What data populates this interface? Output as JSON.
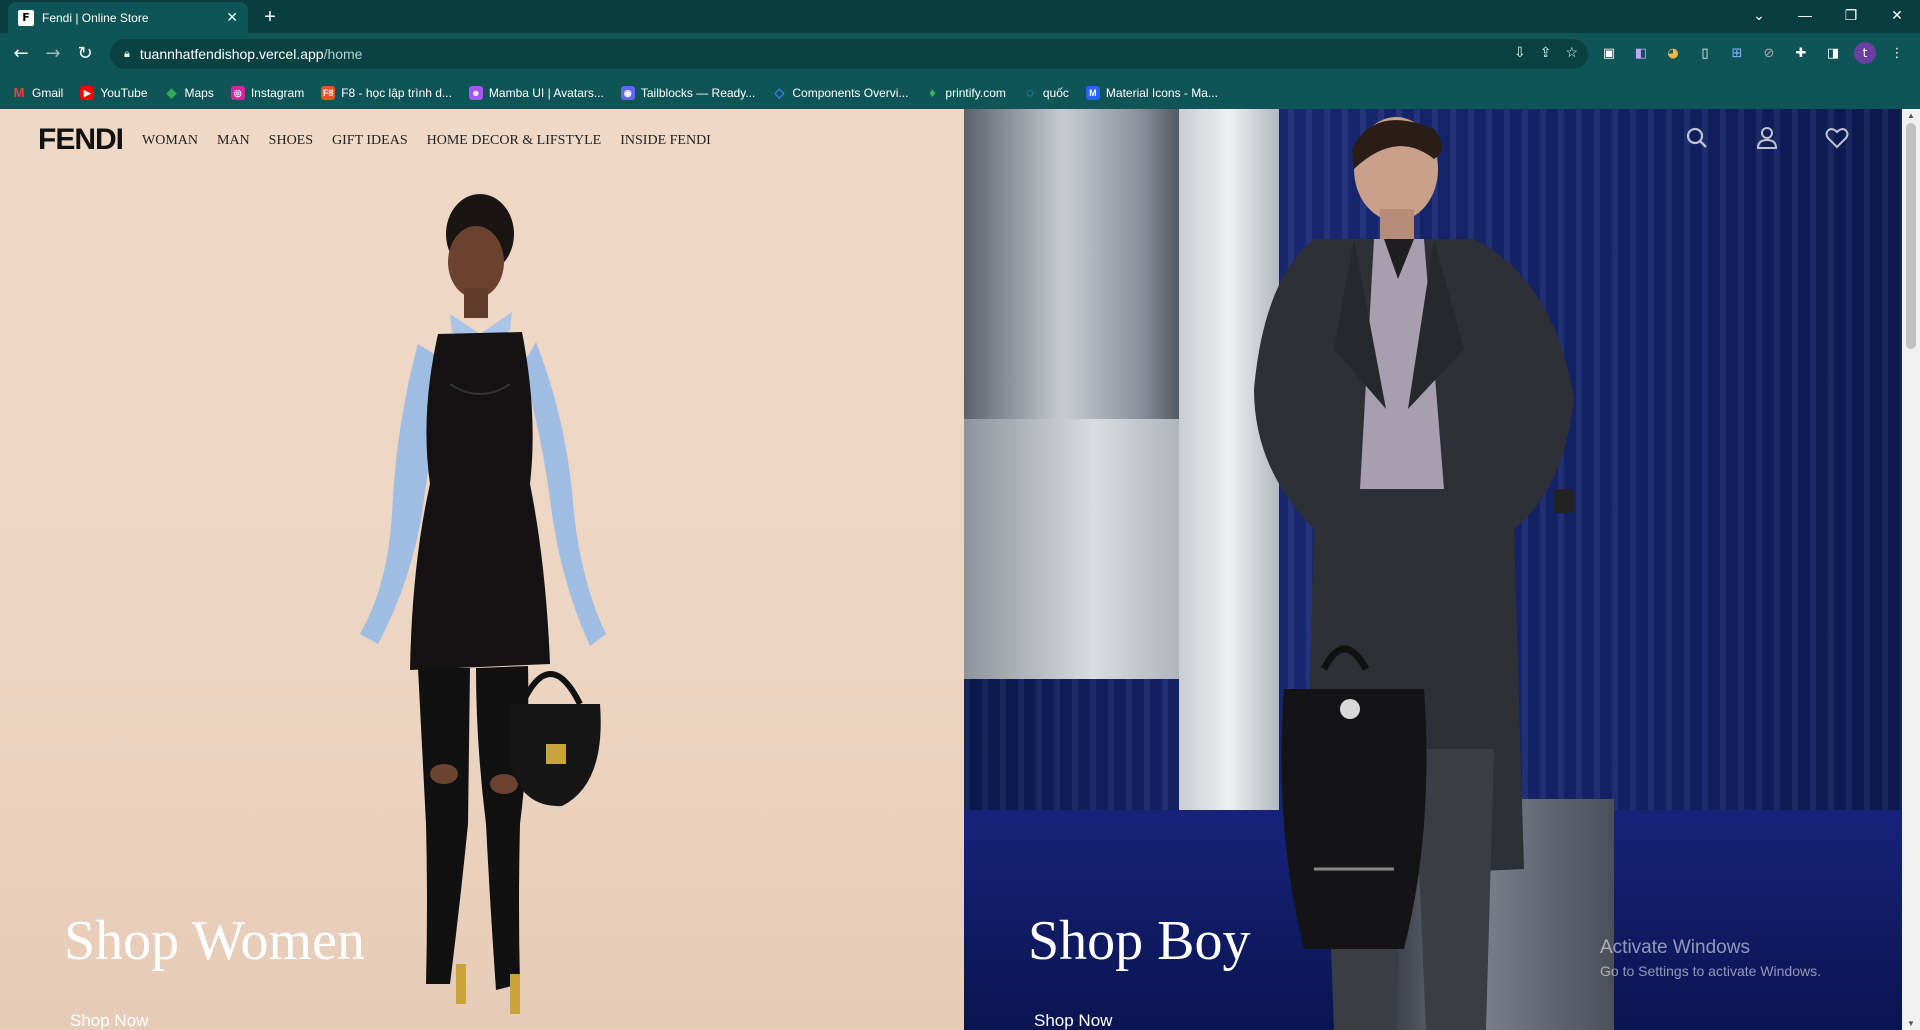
{
  "browser": {
    "tab_title": "Fendi | Online Store",
    "tab_favicon": "F",
    "new_tab": "+",
    "url_host": "tuannhatfendishop.vercel.app",
    "url_path": "/home",
    "bookmarks": [
      {
        "label": "Gmail",
        "icon": "gmail-icon",
        "color": "#ea4335"
      },
      {
        "label": "YouTube",
        "icon": "youtube-icon",
        "color": "#ff0000"
      },
      {
        "label": "Maps",
        "icon": "maps-icon",
        "color": "#34a853"
      },
      {
        "label": "Instagram",
        "icon": "instagram-icon",
        "color": "#d6249f"
      },
      {
        "label": "F8 - học lập trình d...",
        "icon": "f8-icon",
        "color": "#f05123"
      },
      {
        "label": "Mamba UI | Avatars...",
        "icon": "mamba-icon",
        "color": "#a855f7"
      },
      {
        "label": "Tailblocks — Ready...",
        "icon": "tailblocks-icon",
        "color": "#6366f1"
      },
      {
        "label": "Components Overvi...",
        "icon": "components-icon",
        "color": "#3b82f6"
      },
      {
        "label": "printify.com",
        "icon": "printify-icon",
        "color": "#39b75d"
      },
      {
        "label": "quốc",
        "icon": "quoc-icon",
        "color": "#38bdf8"
      },
      {
        "label": "Material Icons - Ma...",
        "icon": "material-icons-icon",
        "color": "#2962ff"
      }
    ],
    "profile_initial": "t"
  },
  "site": {
    "logo": "FENDI",
    "nav": [
      "WOMAN",
      "MAN",
      "SHOES",
      "GIFT IDEAS",
      "HOME DECOR & LIFSTYLE",
      "INSIDE FENDI"
    ],
    "icons": [
      "search-icon",
      "user-icon",
      "heart-icon"
    ]
  },
  "hero": {
    "left": {
      "title": "Shop Women",
      "cta": "Shop Now"
    },
    "right": {
      "title": "Shop Boy",
      "cta": "Shop Now"
    }
  },
  "watermark": {
    "line1": "Activate Windows",
    "line2": "Go to Settings to activate Windows."
  }
}
